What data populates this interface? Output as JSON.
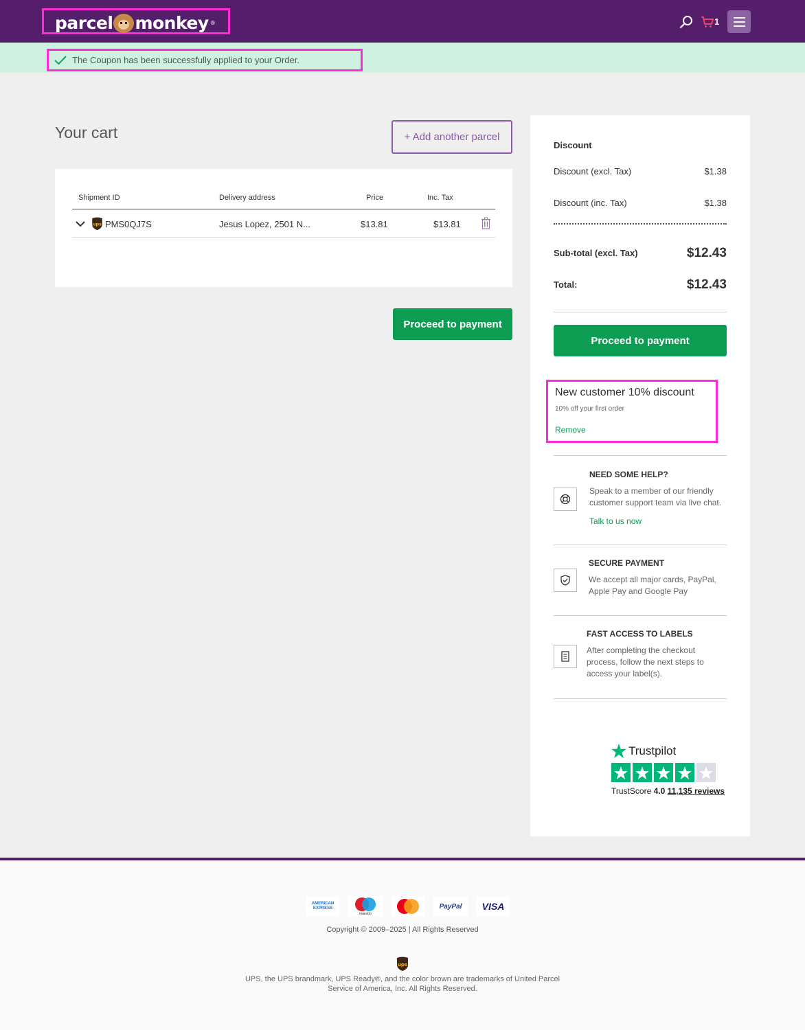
{
  "header": {
    "logo_left": "parcel",
    "logo_right": "monkey",
    "logo_reg": "®",
    "cart_count": "1"
  },
  "banner": {
    "message": "The Coupon has been successfully applied to your Order."
  },
  "cart": {
    "title": "Your cart",
    "add_parcel_label": "+ Add another parcel",
    "columns": [
      "Shipment ID",
      "Delivery address",
      "Price",
      "Inc. Tax"
    ],
    "rows": [
      {
        "shipment_id": "PMS0QJ7S",
        "address": "Jesus Lopez, 2501 N...",
        "price": "$13.81",
        "inc_tax": "$13.81"
      }
    ],
    "proceed_label": "Proceed to payment"
  },
  "summary": {
    "discount_heading": "Discount",
    "discount_excl_label": "Discount (excl. Tax)",
    "discount_excl_value": "$1.38",
    "discount_inc_label": "Discount (inc. Tax)",
    "discount_inc_value": "$1.38",
    "subtotal_label": "Sub-total (excl. Tax)",
    "subtotal_value": "$12.43",
    "total_label": "Total:",
    "total_value": "$12.43",
    "proceed_label": "Proceed to payment"
  },
  "promo": {
    "title": "New customer 10% discount",
    "subtitle": "10% off your first order",
    "remove_label": "Remove"
  },
  "help": {
    "title": "NEED SOME HELP?",
    "text": "Speak to a member of our friendly customer support team via live chat.",
    "link": "Talk to us now"
  },
  "secure": {
    "title": "SECURE PAYMENT",
    "text": "We accept all major cards, PayPal, Apple Pay and Google Pay"
  },
  "labels": {
    "title": "FAST ACCESS TO LABELS",
    "text": "After completing the checkout process, follow the next steps to access your label(s)."
  },
  "trustpilot": {
    "name": "Trustpilot",
    "score_label": "TrustScore",
    "score": "4.0",
    "reviews": "11,135 reviews",
    "rating": 4,
    "max": 5
  },
  "footer": {
    "payment_methods": [
      "AMERICAN EXPRESS",
      "maestro",
      "mastercard",
      "PayPal",
      "VISA"
    ],
    "copyright": "Copyright © 2009–2025 | All Rights Reserved",
    "ups_note": "UPS, the UPS brandmark, UPS Ready®, and the color brown are trademarks of United Parcel Service of America, Inc. All Rights Reserved."
  },
  "colors": {
    "brand_purple": "#541e6b",
    "accent_green": "#0c9d53",
    "success_bg": "#cff1e2",
    "trustpilot_green": "#00b67a"
  }
}
